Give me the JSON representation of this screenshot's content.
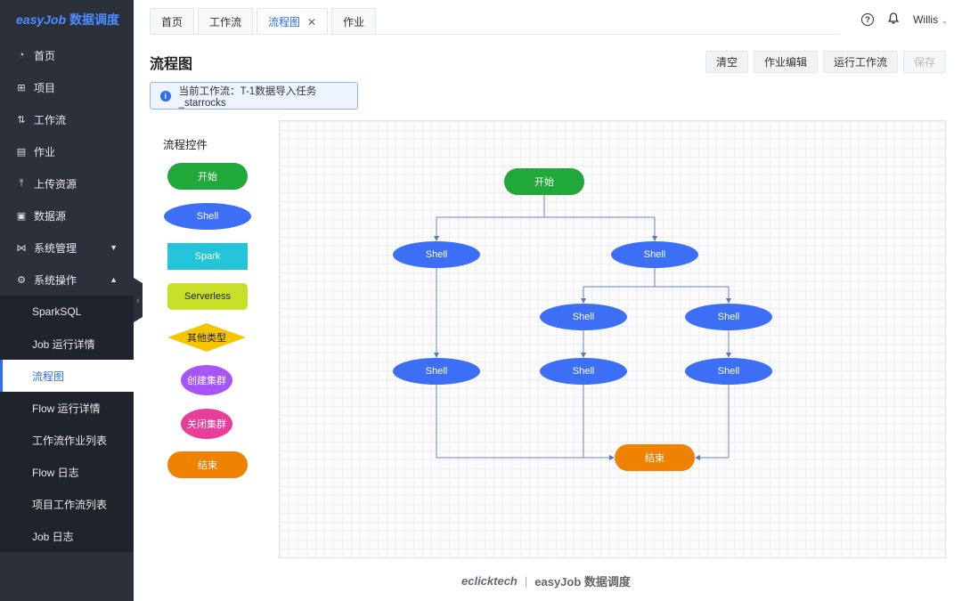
{
  "app": {
    "logo_brand": "easyJob",
    "logo_suffix": "数据调度"
  },
  "sidebar": {
    "items": [
      {
        "label": "首页",
        "icon": "dashboard-icon"
      },
      {
        "label": "项目",
        "icon": "project-icon"
      },
      {
        "label": "工作流",
        "icon": "workflow-icon"
      },
      {
        "label": "作业",
        "icon": "job-icon"
      },
      {
        "label": "上传资源",
        "icon": "upload-icon"
      },
      {
        "label": "数据源",
        "icon": "datasource-icon"
      },
      {
        "label": "系统管理",
        "icon": "system-manage-icon"
      },
      {
        "label": "系统操作",
        "icon": "gear-icon"
      }
    ],
    "subitems": [
      {
        "label": "SparkSQL"
      },
      {
        "label": "Job 运行详情"
      },
      {
        "label": "流程图",
        "active": true
      },
      {
        "label": "Flow 运行详情"
      },
      {
        "label": "工作流作业列表"
      },
      {
        "label": "Flow 日志"
      },
      {
        "label": "项目工作流列表"
      },
      {
        "label": "Job 日志"
      }
    ]
  },
  "tabs": [
    {
      "label": "首页"
    },
    {
      "label": "工作流"
    },
    {
      "label": "流程图",
      "active": true,
      "closable": true
    },
    {
      "label": "作业"
    }
  ],
  "topbar": {
    "user": "Willis"
  },
  "page": {
    "title": "流程图",
    "buttons": {
      "clear": "清空",
      "edit": "作业编辑",
      "run": "运行工作流",
      "save": "保存"
    },
    "notice": "当前工作流：T-1数据导入任务_starrocks"
  },
  "palette": {
    "title": "流程控件",
    "items": [
      {
        "label": "开始",
        "color": "#21a83a"
      },
      {
        "label": "Shell",
        "color": "#3c6ff5"
      },
      {
        "label": "Spark",
        "color": "#23c3d9"
      },
      {
        "label": "Serverless",
        "color": "#c8df2a"
      },
      {
        "label": "其他类型",
        "color": "#f7c500"
      },
      {
        "label": "创建集群",
        "color": "#a855f7"
      },
      {
        "label": "关闭集群",
        "color": "#e83e9a"
      },
      {
        "label": "结束",
        "color": "#ef8200"
      }
    ]
  },
  "flow": {
    "start": "开始",
    "shell": "Shell",
    "end": "结束"
  },
  "footer": {
    "company": "eclicktech",
    "product": "easyJob 数据调度"
  }
}
